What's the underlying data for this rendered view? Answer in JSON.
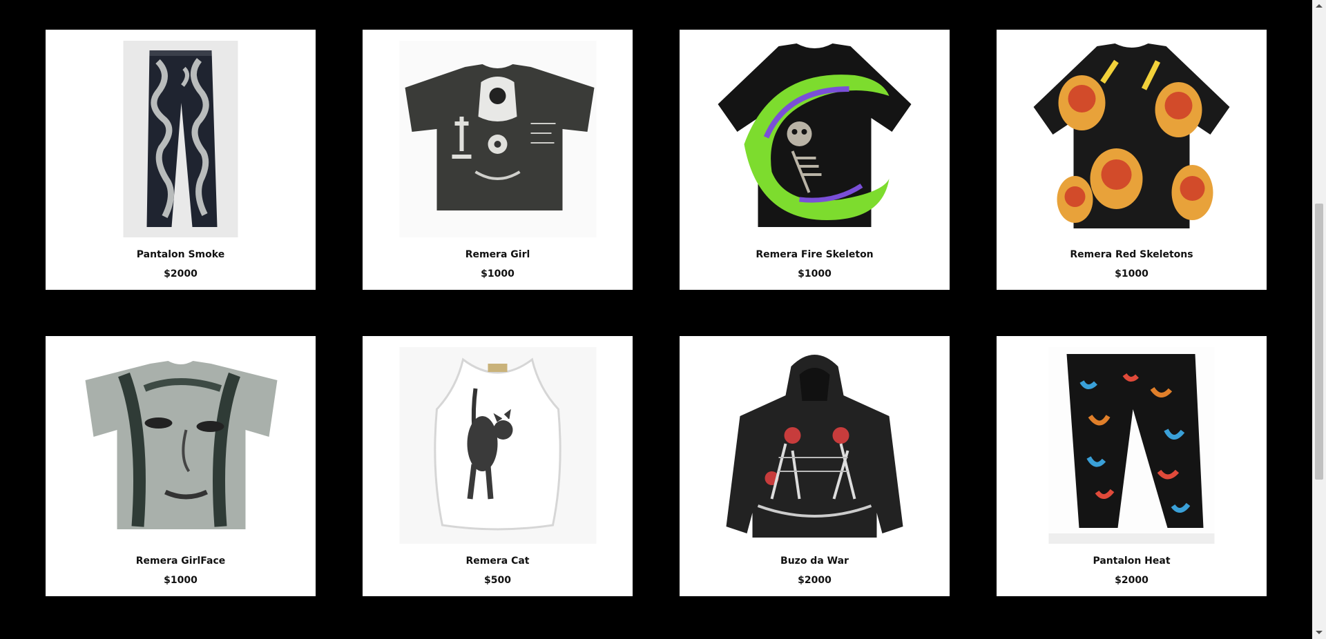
{
  "products": [
    {
      "name": "Pantalon Smoke",
      "price": "$2000",
      "image": "smoke-pants-image"
    },
    {
      "name": "Remera Girl",
      "price": "$1000",
      "image": "girl-tshirt-image"
    },
    {
      "name": "Remera Fire Skeleton",
      "price": "$1000",
      "image": "fire-skeleton-tshirt-image"
    },
    {
      "name": "Remera Red Skeletons",
      "price": "$1000",
      "image": "red-skeletons-tshirt-image"
    },
    {
      "name": "Remera GirlFace",
      "price": "$1000",
      "image": "girlface-tshirt-image"
    },
    {
      "name": "Remera Cat",
      "price": "$500",
      "image": "cat-tanktop-image"
    },
    {
      "name": "Buzo da War",
      "price": "$2000",
      "image": "war-hoodie-image"
    },
    {
      "name": "Pantalon Heat",
      "price": "$2000",
      "image": "heat-pants-image"
    }
  ],
  "colors": {
    "background": "#000000",
    "card": "#ffffff",
    "text": "#111111"
  }
}
